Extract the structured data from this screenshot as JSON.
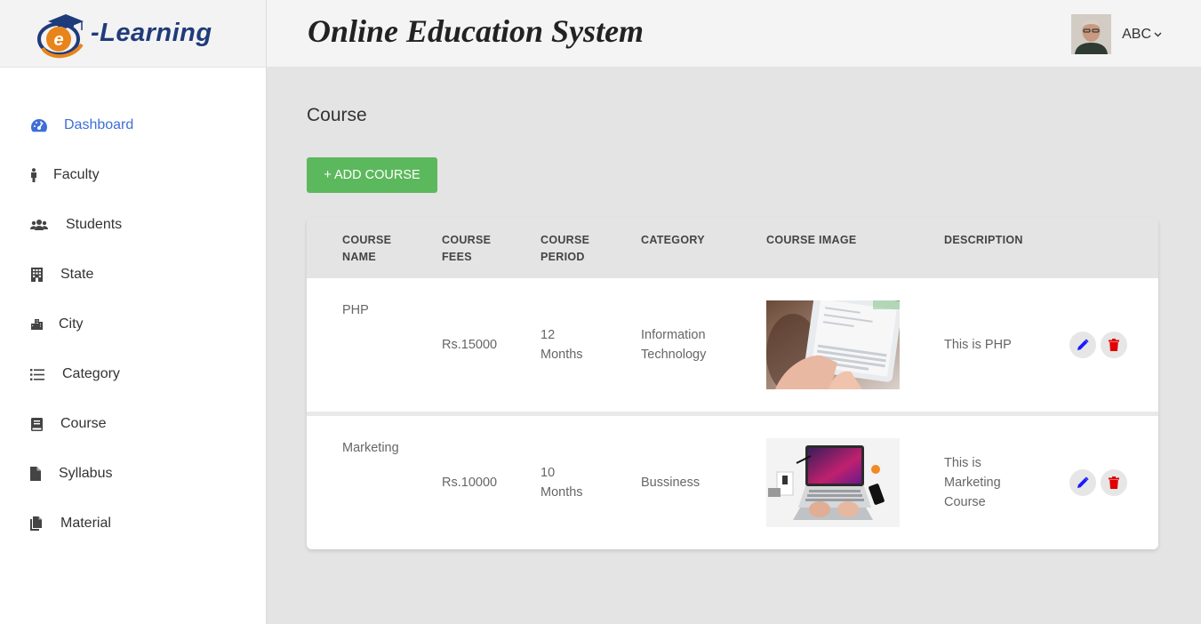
{
  "brand": {
    "logo_text": "-Learning",
    "logo_letter": "e"
  },
  "header": {
    "title": "Online Education System",
    "user_name": "ABC"
  },
  "sidebar": {
    "items": [
      {
        "label": "Dashboard",
        "icon": "dashboard-icon",
        "active": true
      },
      {
        "label": "Faculty",
        "icon": "person-icon"
      },
      {
        "label": "Students",
        "icon": "users-icon"
      },
      {
        "label": "State",
        "icon": "building-icon"
      },
      {
        "label": "City",
        "icon": "city-icon"
      },
      {
        "label": "Category",
        "icon": "list-icon"
      },
      {
        "label": "Course",
        "icon": "book-icon"
      },
      {
        "label": "Syllabus",
        "icon": "file-icon"
      },
      {
        "label": "Material",
        "icon": "files-icon"
      }
    ]
  },
  "page": {
    "title": "Course",
    "add_button": "+ ADD COURSE"
  },
  "table": {
    "headers": {
      "name": [
        "COURSE",
        "NAME"
      ],
      "fees": [
        "COURSE",
        "FEES"
      ],
      "period": [
        "COURSE",
        "PERIOD"
      ],
      "category": "CATEGORY",
      "image": "COURSE IMAGE",
      "description": "DESCRIPTION"
    },
    "rows": [
      {
        "name": "PHP",
        "fees": "Rs.15000",
        "period": [
          "12",
          "Months"
        ],
        "category": [
          "Information",
          "Technology"
        ],
        "image": "tablet-typing-photo",
        "description": [
          "This is PHP"
        ]
      },
      {
        "name": "Marketing",
        "fees": "Rs.10000",
        "period": [
          "10",
          "Months"
        ],
        "category": [
          "Bussiness"
        ],
        "image": "laptop-desk-photo",
        "description": [
          "This is",
          "Marketing",
          "Course"
        ]
      }
    ]
  },
  "colors": {
    "accent": "#3e6fd8",
    "add_button": "#5cb85c",
    "edit_icon": "#1a1aff",
    "delete_icon": "#e00000"
  }
}
